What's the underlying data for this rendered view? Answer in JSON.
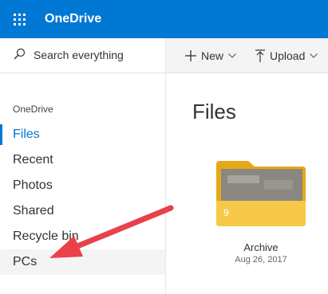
{
  "header": {
    "app_name": "OneDrive"
  },
  "search": {
    "placeholder": "Search everything"
  },
  "sidebar": {
    "section_title": "OneDrive",
    "items": [
      {
        "label": "Files"
      },
      {
        "label": "Recent"
      },
      {
        "label": "Photos"
      },
      {
        "label": "Shared"
      },
      {
        "label": "Recycle bin"
      },
      {
        "label": "PCs"
      }
    ]
  },
  "toolbar": {
    "new_label": "New",
    "upload_label": "Upload"
  },
  "main": {
    "title": "Files",
    "folder": {
      "name": "Archive",
      "date": "Aug 26, 2017",
      "count": "9"
    }
  },
  "colors": {
    "brand": "#0078d4",
    "folder": "#f7c948",
    "annotation_arrow": "#e8414a"
  },
  "icons": [
    "waffle-icon",
    "search-icon",
    "plus-icon",
    "upload-icon",
    "chevron-down-icon",
    "folder-icon",
    "arrow-annotation"
  ]
}
